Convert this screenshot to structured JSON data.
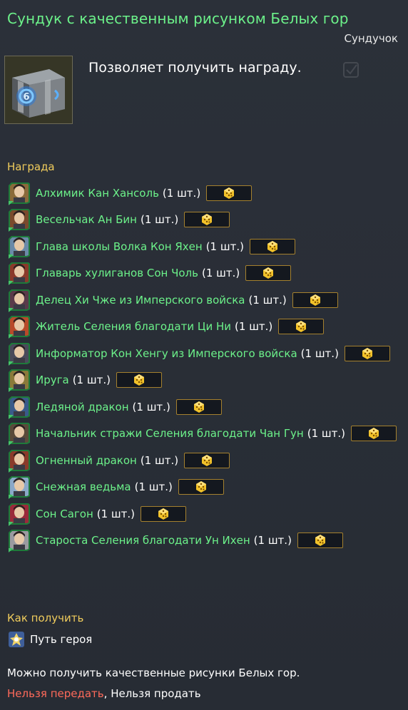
{
  "item": {
    "title": "Сундук с качественным рисунком Белых гор",
    "type": "Сундучок",
    "description": "Позволяет получить награду.",
    "icon": "chest-icon"
  },
  "reward_section": {
    "title": "Награда",
    "items": [
      {
        "name": "Алхимик Кан Хансоль",
        "qty": "(1 шт.)",
        "portrait_color": "#8a6a3a"
      },
      {
        "name": "Весельчак Ан Бин",
        "qty": "(1 шт.)",
        "portrait_color": "#7a4a2c"
      },
      {
        "name": "Глава школы Волка Кон Яхен",
        "qty": "(1 шт.)",
        "portrait_color": "#6b8aa8"
      },
      {
        "name": "Главарь хулиганов Сон Чоль",
        "qty": "(1 шт.)",
        "portrait_color": "#8a3a2a"
      },
      {
        "name": "Делец Хи Чже из Имперского войска",
        "qty": "(1 шт.)",
        "portrait_color": "#5a3a4a"
      },
      {
        "name": "Житель Селения благодати Ци Ни",
        "qty": "(1 шт.)",
        "portrait_color": "#b84a2a"
      },
      {
        "name": "Информатор Кон Хенгу из Имперского войска",
        "qty": "(1 шт.)",
        "portrait_color": "#4a4a5a"
      },
      {
        "name": "Ируга",
        "qty": "(1 шт.)",
        "portrait_color": "#8a7a3a"
      },
      {
        "name": "Ледяной дракон",
        "qty": "(1 шт.)",
        "portrait_color": "#3a5a8a"
      },
      {
        "name": "Начальник стражи Селения благодати Чан Гун",
        "qty": "(1 шт.)",
        "portrait_color": "#5a4a3a"
      },
      {
        "name": "Огненный дракон",
        "qty": "(1 шт.)",
        "portrait_color": "#8a3a2a"
      },
      {
        "name": "Снежная ведьма",
        "qty": "(1 шт.)",
        "portrait_color": "#8aa8c8"
      },
      {
        "name": "Сон Сагон",
        "qty": "(1 шт.)",
        "portrait_color": "#9a2a3a"
      },
      {
        "name": "Староста Селения благодати Ун Ихен",
        "qty": "(1 шт.)",
        "portrait_color": "#9a9aa0"
      }
    ],
    "dice_icon": "dice-icon",
    "dice_color": "#f2c22a"
  },
  "how_to_get": {
    "title": "Как получить",
    "source": "Путь героя",
    "source_icon": "hero-path-icon"
  },
  "note": "Можно получить качественные рисунки Белых гор.",
  "restrictions": {
    "no_transfer": "Нельзя передать",
    "separator": ", ",
    "no_sell": "Нельзя продать"
  },
  "colors": {
    "title": "#6cf28a",
    "section": "#f0cc5c",
    "restricted": "#ff6a5a",
    "button_border": "#a5812e"
  }
}
